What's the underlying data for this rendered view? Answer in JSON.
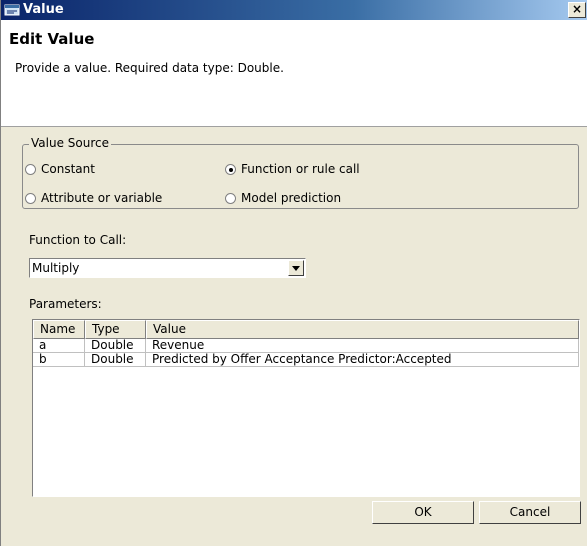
{
  "window": {
    "title": "Value",
    "close_glyph": "×"
  },
  "header": {
    "title": "Edit Value",
    "description": "Provide a value. Required data type: Double."
  },
  "value_source": {
    "legend": "Value Source",
    "options": [
      {
        "label": "Constant",
        "checked": false
      },
      {
        "label": "Function or rule call",
        "checked": true
      },
      {
        "label": "Attribute or variable",
        "checked": false
      },
      {
        "label": "Model prediction",
        "checked": false
      }
    ]
  },
  "function": {
    "label": "Function to Call:",
    "selected": "Multiply"
  },
  "parameters": {
    "label": "Parameters:",
    "columns": [
      "Name",
      "Type",
      "Value"
    ],
    "rows": [
      [
        "a",
        "Double",
        "Revenue"
      ],
      [
        "b",
        "Double",
        "Predicted by Offer Acceptance Predictor:Accepted"
      ]
    ]
  },
  "buttons": {
    "ok": "OK",
    "cancel": "Cancel"
  },
  "icons": {
    "app": "app-window-icon",
    "dropdown": "chevron-down-icon"
  }
}
